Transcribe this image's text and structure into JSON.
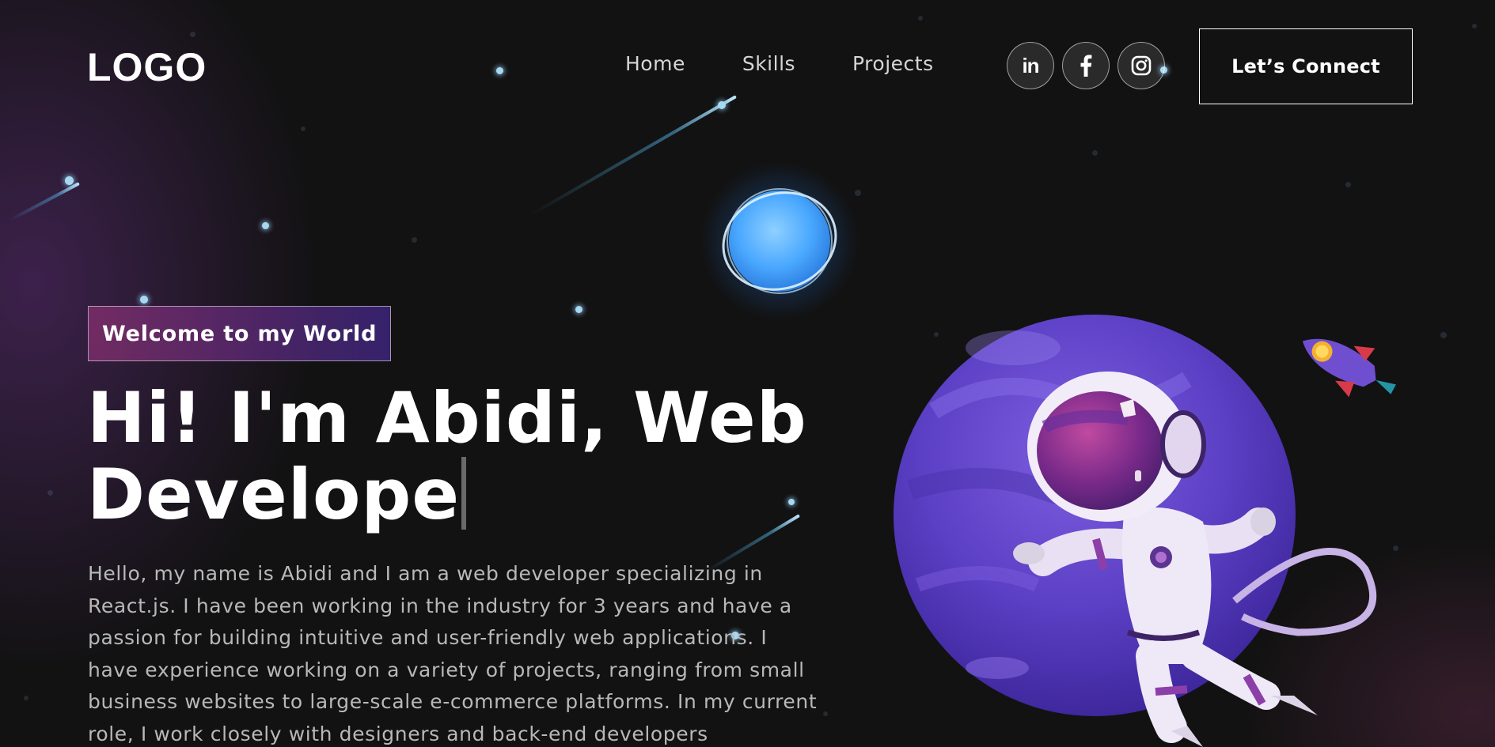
{
  "navbar": {
    "logo": "LOGO",
    "links": [
      {
        "label": "Home"
      },
      {
        "label": "Skills"
      },
      {
        "label": "Projects"
      }
    ],
    "social": [
      {
        "icon": "linkedin-icon",
        "label": "in"
      },
      {
        "icon": "facebook-icon"
      },
      {
        "icon": "instagram-icon"
      }
    ],
    "connect_label": "Let’s Connect"
  },
  "hero": {
    "tagline": "Welcome to my World",
    "headline": "Hi! I'm Abidi, Web Develope",
    "bio": "Hello, my name is Abidi and I am a web developer specializing in React.js. I have been working in the industry for 3 years and have a passion for building intuitive and user-friendly web applications. I have experience working on a variety of projects, ranging from small business websites to large-scale e-commerce platforms. In my current role, I work closely with designers and back-end developers"
  },
  "illustration": {
    "items": [
      "planet-icon",
      "astronaut-icon",
      "rocket-icon",
      "blue-orb-icon"
    ]
  },
  "colors": {
    "background": "#121212",
    "tagline_gradient_start": "#AA367C",
    "tagline_gradient_end": "#4A2FBD",
    "planet": "#5a3fbf",
    "accent_blue": "#4aa8ff"
  }
}
